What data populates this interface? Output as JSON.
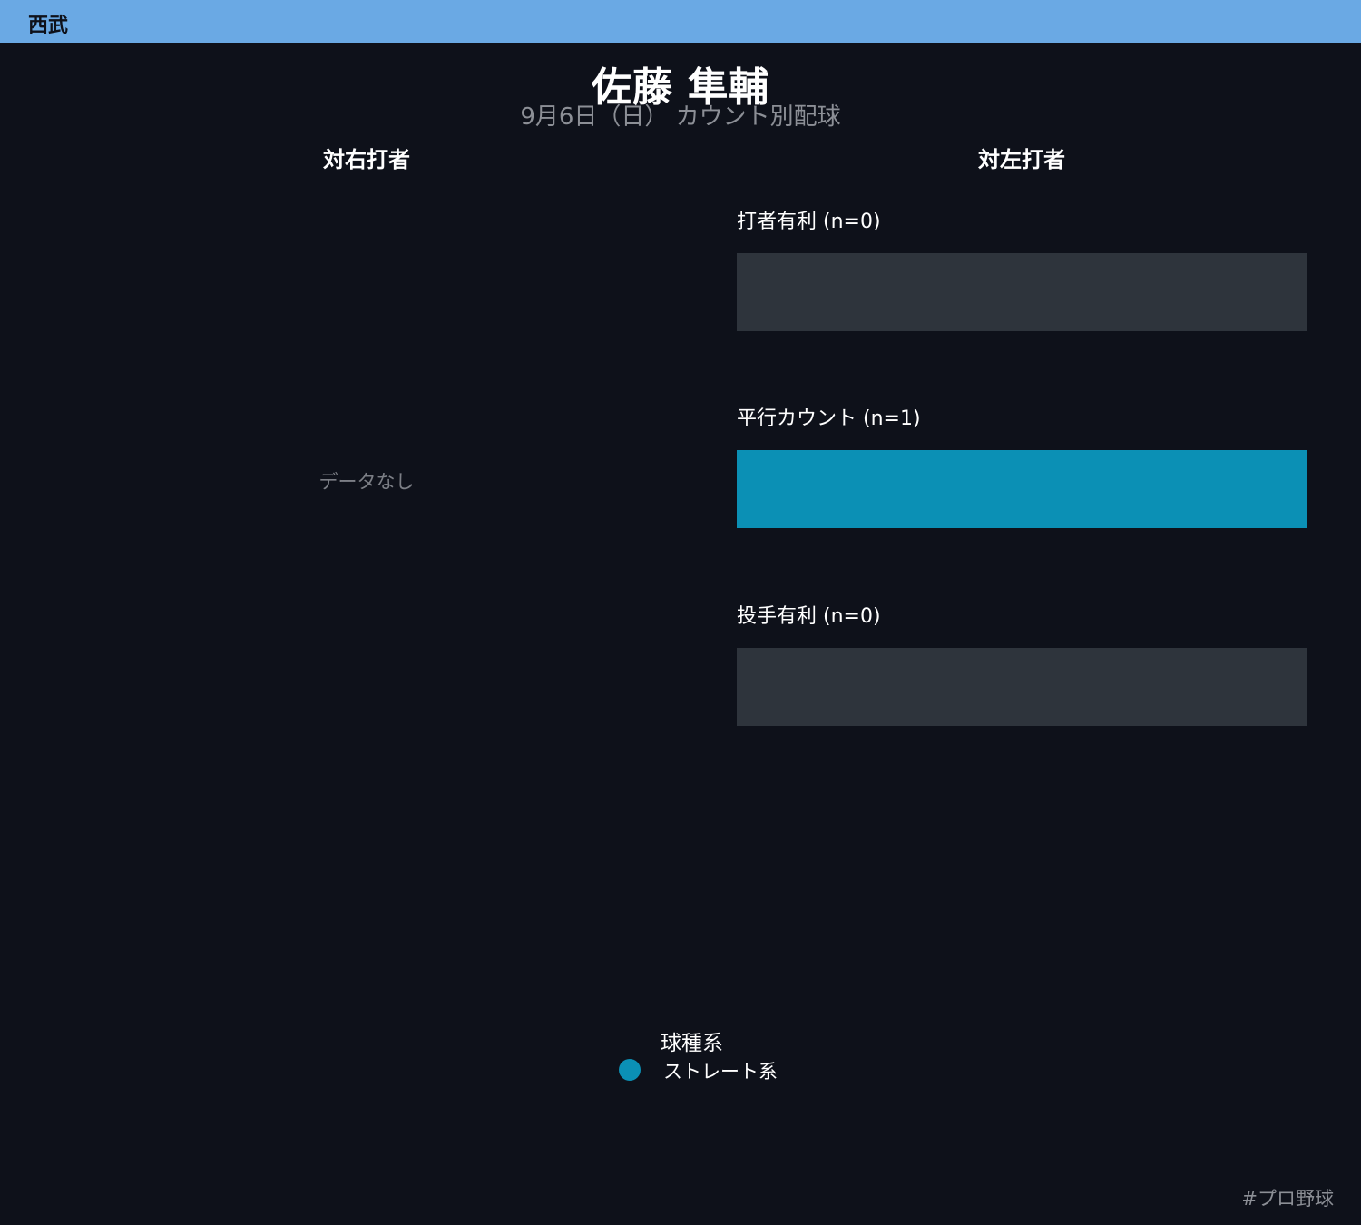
{
  "team": {
    "name": "西武",
    "color": "#6aa9e4"
  },
  "header": {
    "title": "佐藤 隼輔",
    "subtitle": "9月6日（日） カウント別配球"
  },
  "chart_data": [
    {
      "type": "bar",
      "stacked": "percent",
      "title": "対右打者",
      "categories": [],
      "series": [],
      "empty_message": "データなし"
    },
    {
      "type": "bar",
      "stacked": "percent",
      "orientation": "horizontal",
      "title": "対左打者",
      "categories": [
        "打者有利 (n=0)",
        "平行カウント (n=1)",
        "投手有利 (n=0)"
      ],
      "counts": [
        0,
        1,
        0
      ],
      "series": [
        {
          "name": "ストレート系",
          "color": "#0b90b5",
          "values": [
            0,
            1,
            0
          ]
        }
      ],
      "empty_bar_color": "#2e343c"
    }
  ],
  "legend": {
    "title": "球種系",
    "items": [
      {
        "label": "ストレート系",
        "color": "#0b90b5"
      }
    ]
  },
  "footer": {
    "hashtag": "#プロ野球"
  }
}
